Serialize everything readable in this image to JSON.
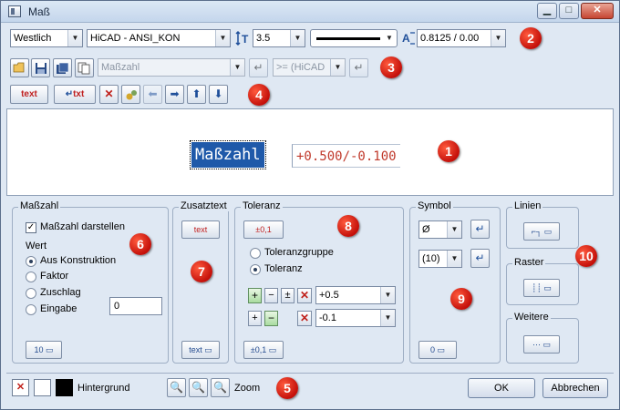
{
  "window": {
    "title": "Maß",
    "controls": [
      "minimize",
      "maximize",
      "close"
    ],
    "close_glyph": "✕",
    "min_glyph": "▁",
    "max_glyph": "□"
  },
  "toolbar1": {
    "style_select": "Westlich",
    "standard_select": "HiCAD - ANSI_KON",
    "size_select": "3.5",
    "tolerance_select": "0.8125 / 0.00",
    "dropdown_glyph": "▼",
    "badge": "2"
  },
  "toolbar2": {
    "text_select": "Maßzahl",
    "filter_select": ">= (HiCAD",
    "badge": "3"
  },
  "toolbar3": {
    "text_button": "text",
    "txt_button": "txt",
    "badge": "4",
    "arrow_left": "⬅",
    "arrow_right": "➡",
    "arrow_up": "⬆",
    "arrow_down": "⬇"
  },
  "preview": {
    "main_text": "Maßzahl",
    "tolerance_text": "+0.500/-0.100",
    "badge": "1"
  },
  "groups": {
    "masszahl": {
      "title": "Maßzahl",
      "show_label": "Maßzahl darstellen",
      "show_checked": "✓",
      "wert_label": "Wert",
      "options": [
        "Aus Konstruktion",
        "Faktor",
        "Zuschlag",
        "Eingabe"
      ],
      "input_value": "0",
      "button_label": "10",
      "badge": "6"
    },
    "zusatztext": {
      "title": "Zusatztext",
      "top_button": "text",
      "bottom_button": "text",
      "badge": "7"
    },
    "toleranz": {
      "title": "Toleranz",
      "top_button": "±0,1",
      "options": [
        "Toleranzgruppe",
        "Toleranz"
      ],
      "upper_value": "+0.5",
      "lower_value": "-0.1",
      "plus": "+",
      "minus": "−",
      "plusminus": "±",
      "bottom_button": "±0,1",
      "badge": "8"
    },
    "symbol": {
      "title": "Symbol",
      "select1": "Ø",
      "select2": "(10)",
      "bottom_button": "0",
      "badge": "9"
    },
    "linien": {
      "title": "Linien"
    },
    "raster": {
      "title": "Raster",
      "badge": "10"
    },
    "weitere": {
      "title": "Weitere"
    }
  },
  "bottom": {
    "hintergrund_label": "Hintergrund",
    "zoom_label": "Zoom",
    "ok_label": "OK",
    "cancel_label": "Abbrechen",
    "badge": "5"
  }
}
